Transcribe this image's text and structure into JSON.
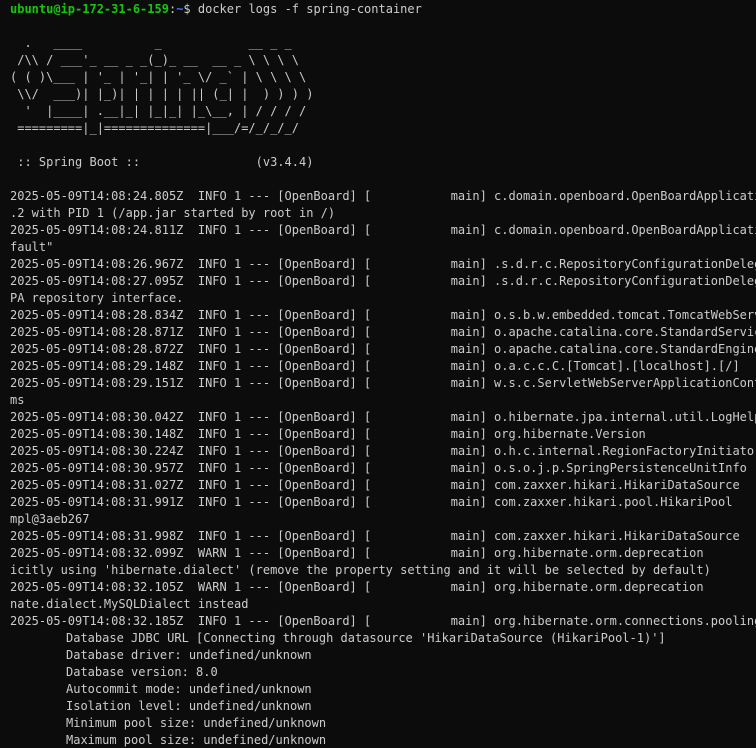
{
  "prompt": {
    "user_host": "ubuntu@ip-172-31-6-159",
    "sep": ":",
    "path": "~",
    "symbol": "$ ",
    "command": "docker logs -f spring-container"
  },
  "banner": [
    "  .   ____          _            __ _ _",
    " /\\\\ / ___'_ __ _ _(_)_ __  __ _ \\ \\ \\ \\",
    "( ( )\\___ | '_ | '_| | '_ \\/ _` | \\ \\ \\ \\",
    " \\\\/  ___)| |_)| | | | | || (_| |  ) ) ) )",
    "  '  |____| .__|_| |_|_| |_\\__, | / / / /",
    " =========|_|==============|___/=/_/_/_/"
  ],
  "spring_boot_line": " :: Spring Boot ::                (v3.4.4)",
  "log_lines": [
    "2025-05-09T14:08:24.805Z  INFO 1 --- [OpenBoard] [           main] c.domain.openboard.OpenBoardApplication",
    ".2 with PID 1 (/app.jar started by root in /)",
    "2025-05-09T14:08:24.811Z  INFO 1 --- [OpenBoard] [           main] c.domain.openboard.OpenBoardApplication",
    "fault\"",
    "2025-05-09T14:08:26.967Z  INFO 1 --- [OpenBoard] [           main] .s.d.r.c.RepositoryConfigurationDelegate",
    "2025-05-09T14:08:27.095Z  INFO 1 --- [OpenBoard] [           main] .s.d.r.c.RepositoryConfigurationDelegate",
    "PA repository interface.",
    "2025-05-09T14:08:28.834Z  INFO 1 --- [OpenBoard] [           main] o.s.b.w.embedded.tomcat.TomcatWebServer",
    "2025-05-09T14:08:28.871Z  INFO 1 --- [OpenBoard] [           main] o.apache.catalina.core.StandardService",
    "2025-05-09T14:08:28.872Z  INFO 1 --- [OpenBoard] [           main] o.apache.catalina.core.StandardEngine",
    "2025-05-09T14:08:29.148Z  INFO 1 --- [OpenBoard] [           main] o.a.c.c.C.[Tomcat].[localhost].[/]",
    "2025-05-09T14:08:29.151Z  INFO 1 --- [OpenBoard] [           main] w.s.c.ServletWebServerApplicationContext",
    "ms",
    "2025-05-09T14:08:30.042Z  INFO 1 --- [OpenBoard] [           main] o.hibernate.jpa.internal.util.LogHelper",
    "2025-05-09T14:08:30.148Z  INFO 1 --- [OpenBoard] [           main] org.hibernate.Version",
    "2025-05-09T14:08:30.224Z  INFO 1 --- [OpenBoard] [           main] o.h.c.internal.RegionFactoryInitiator",
    "2025-05-09T14:08:30.957Z  INFO 1 --- [OpenBoard] [           main] o.s.o.j.p.SpringPersistenceUnitInfo",
    "2025-05-09T14:08:31.027Z  INFO 1 --- [OpenBoard] [           main] com.zaxxer.hikari.HikariDataSource",
    "2025-05-09T14:08:31.991Z  INFO 1 --- [OpenBoard] [           main] com.zaxxer.hikari.pool.HikariPool",
    "mpl@3aeb267",
    "2025-05-09T14:08:31.998Z  INFO 1 --- [OpenBoard] [           main] com.zaxxer.hikari.HikariDataSource",
    "2025-05-09T14:08:32.099Z  WARN 1 --- [OpenBoard] [           main] org.hibernate.orm.deprecation",
    "icitly using 'hibernate.dialect' (remove the property setting and it will be selected by default)",
    "2025-05-09T14:08:32.105Z  WARN 1 --- [OpenBoard] [           main] org.hibernate.orm.deprecation",
    "nate.dialect.MySQLDialect instead",
    "2025-05-09T14:08:32.185Z  INFO 1 --- [OpenBoard] [           main] org.hibernate.orm.connections.pooling"
  ],
  "db_info_lines": [
    "Database JDBC URL [Connecting through datasource 'HikariDataSource (HikariPool-1)']",
    "Database driver: undefined/unknown",
    "Database version: 8.0",
    "Autocommit mode: undefined/unknown",
    "Isolation level: undefined/unknown",
    "Minimum pool size: undefined/unknown",
    "Maximum pool size: undefined/unknown"
  ],
  "colors": {
    "background": "#0c0c0c",
    "text": "#cccccc",
    "prompt_user": "#16c60c",
    "prompt_path": "#3b78ff"
  }
}
